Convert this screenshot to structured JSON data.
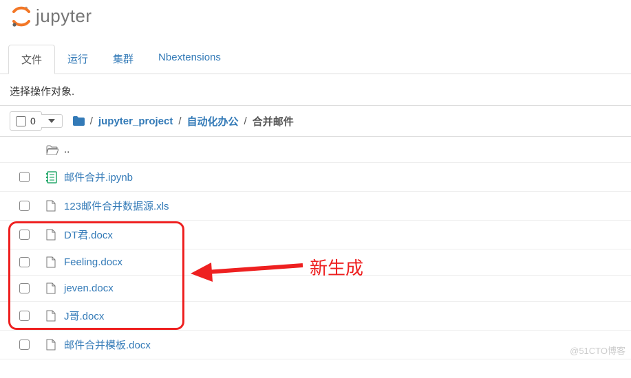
{
  "logo_text": "jupyter",
  "tabs": {
    "files": "文件",
    "running": "运行",
    "clusters": "集群",
    "nbext": "Nbextensions"
  },
  "subheader": "选择操作对象.",
  "select_count": "0",
  "breadcrumb": {
    "p1": "jupyter_project",
    "p2": "自动化办公",
    "p3": "合并邮件",
    "sep": "/"
  },
  "rows": {
    "up": "..",
    "r0": "邮件合并.ipynb",
    "r1": "123邮件合并数据源.xls",
    "r2": "DT君.docx",
    "r3": "Feeling.docx",
    "r4": "jeven.docx",
    "r5": "J哥.docx",
    "r6": "邮件合并模板.docx"
  },
  "annotation": "新生成",
  "watermark": "@51CTO博客"
}
